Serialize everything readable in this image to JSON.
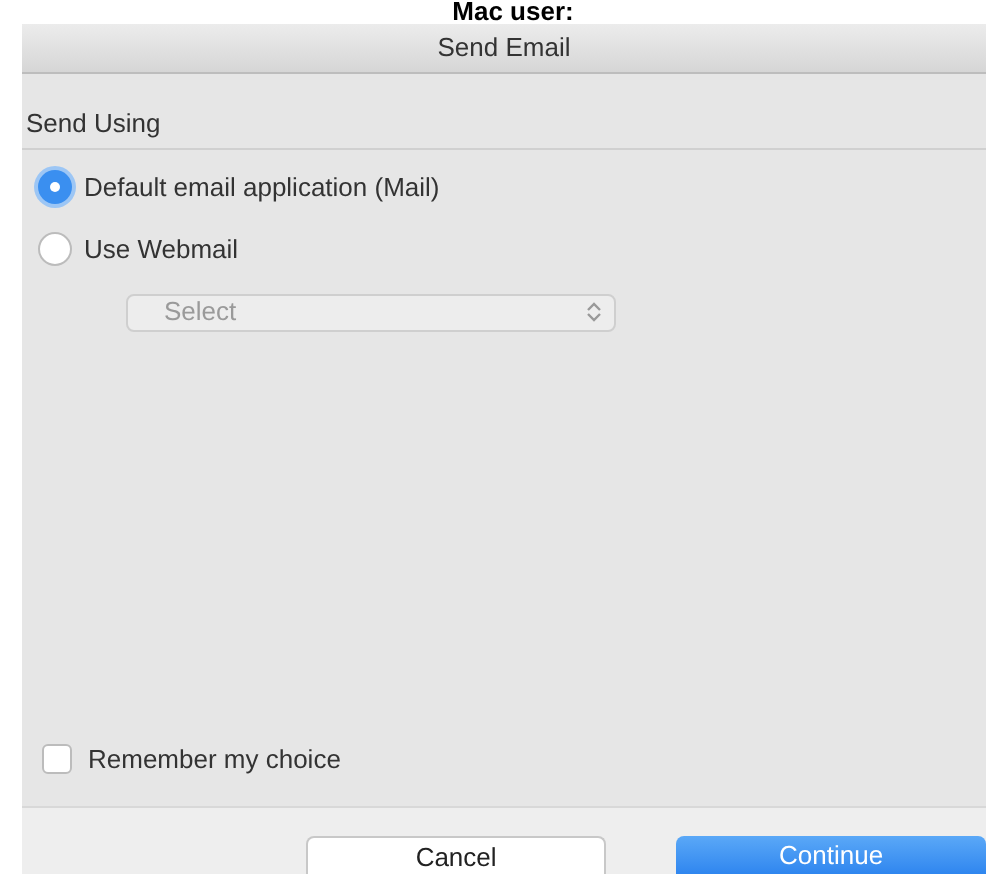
{
  "heading": "Mac user:",
  "window": {
    "title": "Send Email"
  },
  "section": {
    "label": "Send Using"
  },
  "options": [
    {
      "label": "Default email application (Mail)",
      "selected": true
    },
    {
      "label": "Use Webmail",
      "selected": false
    }
  ],
  "select": {
    "placeholder": "Select",
    "disabled": true
  },
  "remember": {
    "label": "Remember my choice",
    "checked": false
  },
  "buttons": [
    {
      "label": "Cancel",
      "kind": "secondary"
    },
    {
      "label": "Continue",
      "kind": "primary"
    }
  ]
}
